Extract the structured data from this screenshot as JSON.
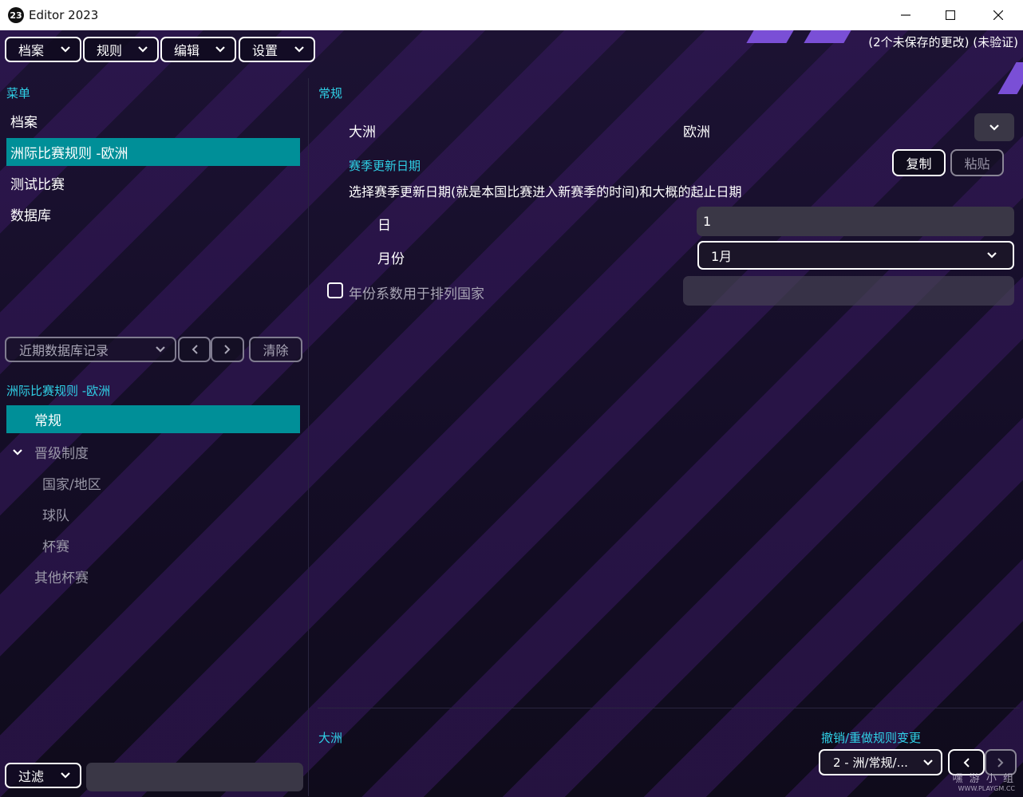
{
  "window": {
    "title": "Editor 2023",
    "app_icon": "23"
  },
  "toolbar": {
    "menus": [
      {
        "label": "档案"
      },
      {
        "label": "规则"
      },
      {
        "label": "编辑"
      },
      {
        "label": "设置"
      }
    ],
    "status": "(2个未保存的更改) (未验证)"
  },
  "sidebar": {
    "menu_title": "菜单",
    "items": [
      {
        "label": "档案"
      },
      {
        "label": "洲际比赛规则 -欧洲"
      },
      {
        "label": "测试比赛"
      },
      {
        "label": "数据库"
      }
    ],
    "recent": {
      "label": "近期数据库记录",
      "clear": "清除"
    },
    "tree_title": "洲际比赛规则 -欧洲",
    "tree": [
      {
        "label": "常规"
      },
      {
        "label": "晋级制度"
      },
      {
        "label": "国家/地区"
      },
      {
        "label": "球队"
      },
      {
        "label": "杯赛"
      },
      {
        "label": "其他杯赛"
      }
    ],
    "filter": {
      "label": "过滤",
      "value": ""
    }
  },
  "main": {
    "section_title": "常规",
    "continent": {
      "label": "大洲",
      "value": "欧洲"
    },
    "season_title": "赛季更新日期",
    "copy": "复制",
    "paste": "粘贴",
    "season_description": "选择赛季更新日期(就是本国比赛进入新赛季的时间)和大概的起止日期",
    "day": {
      "label": "日",
      "value": "1"
    },
    "month": {
      "label": "月份",
      "value": "1月"
    },
    "year_checkbox": {
      "label": "年份系数用于排列国家",
      "checked": false
    }
  },
  "footer": {
    "left_label": "大洲",
    "undo_title": "撤销/重做规则变更",
    "undo_value": "2 - 洲/常规/..."
  },
  "watermark": {
    "line1": "嘿 游 小 组",
    "line2": "WWW.PLAYGM.CC"
  },
  "colors": {
    "accent_teal": "#008f98",
    "label_cyan": "#2fd0e6",
    "deco_purple": "#7a4fd6"
  }
}
